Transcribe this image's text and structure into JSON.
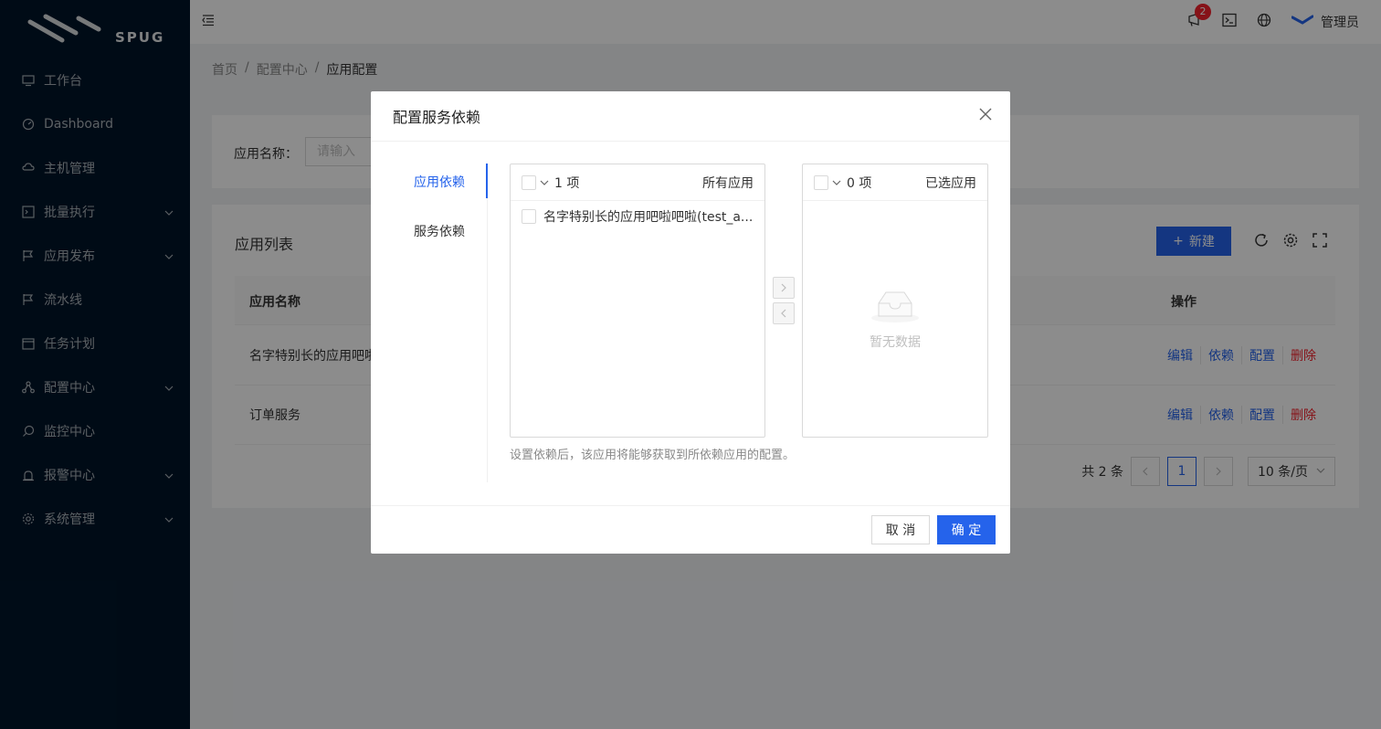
{
  "brand": {
    "name": "SPUG"
  },
  "sidebar": {
    "items": [
      {
        "label": "工作台",
        "icon": "desktop-icon",
        "has_children": false
      },
      {
        "label": "Dashboard",
        "icon": "dashboard-icon",
        "has_children": false
      },
      {
        "label": "主机管理",
        "icon": "cloud-server-icon",
        "has_children": false
      },
      {
        "label": "批量执行",
        "icon": "code-icon",
        "has_children": true
      },
      {
        "label": "应用发布",
        "icon": "flag-icon",
        "has_children": true
      },
      {
        "label": "流水线",
        "icon": "pipeline-icon",
        "has_children": false
      },
      {
        "label": "任务计划",
        "icon": "schedule-icon",
        "has_children": false
      },
      {
        "label": "配置中心",
        "icon": "cluster-icon",
        "has_children": true
      },
      {
        "label": "监控中心",
        "icon": "monitor-icon",
        "has_children": false
      },
      {
        "label": "报警中心",
        "icon": "alert-icon",
        "has_children": true
      },
      {
        "label": "系统管理",
        "icon": "setting-icon",
        "has_children": true
      }
    ]
  },
  "header": {
    "notification_count": "2",
    "user_name": "管理员"
  },
  "breadcrumb": [
    "首页",
    "配置中心",
    "应用配置"
  ],
  "search": {
    "label": "应用名称：",
    "placeholder": "请输入"
  },
  "app_list": {
    "title": "应用列表",
    "new_label": "新建",
    "columns": [
      "应用名称",
      "操作"
    ],
    "rows": [
      {
        "name": "名字特别长的应用吧啦"
      },
      {
        "name": "订单服务"
      }
    ],
    "actions": [
      "编辑",
      "依赖",
      "配置",
      "删除"
    ],
    "pagination": {
      "total": "共 2 条",
      "current": "1",
      "page_size": "10 条/页"
    }
  },
  "modal": {
    "title": "配置服务依赖",
    "tabs": [
      "应用依赖",
      "服务依赖"
    ],
    "left_list": {
      "count": "1 项",
      "title": "所有应用",
      "items": [
        "名字特别长的应用吧啦吧啦(test_a..."
      ]
    },
    "right_list": {
      "count": "0 项",
      "title": "已选应用",
      "empty": "暂无数据"
    },
    "hint": "设置依赖后，该应用将能够获取到所依赖应用的配置。",
    "cancel_label": "取 消",
    "ok_label": "确 定"
  },
  "colors": {
    "primary": "#2563eb",
    "danger": "#f5222d",
    "sidebar_bg": "#001529"
  }
}
